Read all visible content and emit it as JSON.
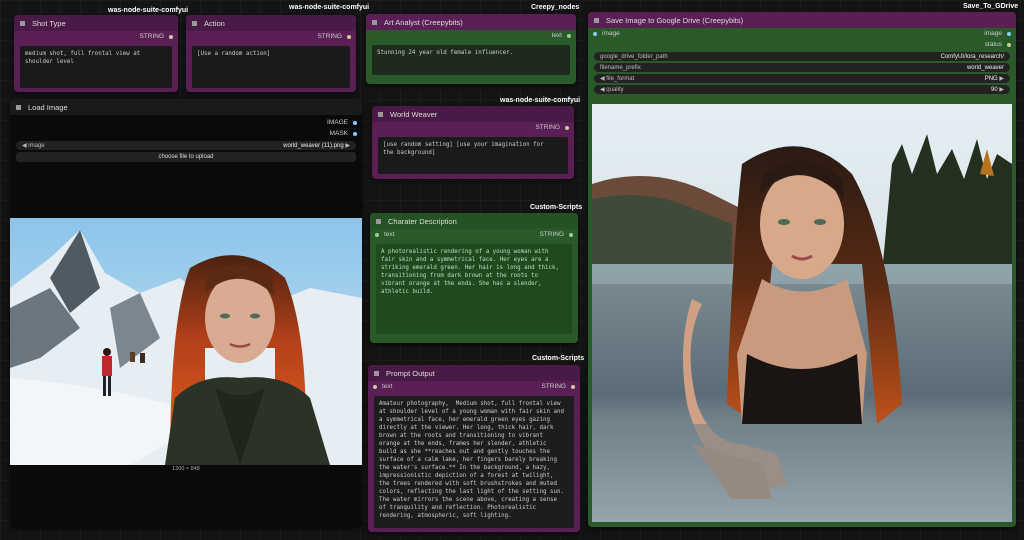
{
  "groups": {
    "shot_type": "was-node-suite-comfyui",
    "action": "was-node-suite-comfyui",
    "art_analyst": "Creepy_nodes",
    "save_drive": "Save_To_GDrive",
    "world_weaver": "was-node-suite-comfyui",
    "character": "Custom-Scripts",
    "prompt_output": "Custom-Scripts"
  },
  "shot_type": {
    "title": "Shot Type",
    "output": "STRING",
    "text": "medium shot, full frontal view at\nshoulder level"
  },
  "action": {
    "title": "Action",
    "output": "STRING",
    "text": "[Use a random action]"
  },
  "art_analyst": {
    "title": "Art Analyst (Creepybits)",
    "output": "text",
    "text": "Stunning 24 year old female influencer."
  },
  "save_drive": {
    "title": "Save Image to Google Drive (Creepybits)",
    "input": "image",
    "out_image": "image",
    "out_status": "status",
    "fields": [
      {
        "label": "google_drive_folder_path",
        "value": "ComfyUI/lora_research/"
      },
      {
        "label": "filename_prefix",
        "value": "world_weaver"
      },
      {
        "label": "file_format",
        "value": "PNG"
      },
      {
        "label": "quality",
        "value": "90"
      }
    ]
  },
  "load_image": {
    "title": "Load Image",
    "out_image": "IMAGE",
    "out_mask": "MASK",
    "image_label": "image",
    "image_value": "world_weaver (11).png",
    "upload_label": "choose file to upload",
    "dims": "1200 × 848"
  },
  "world_weaver": {
    "title": "World Weaver",
    "output": "STRING",
    "text": "[use random setting] [use your imagination for\nthe background]"
  },
  "character": {
    "title": "Charater Description",
    "input": "text",
    "output": "STRING",
    "text": "A photorealistic rendering of a young woman with\nfair skin and a symmetrical face. Her eyes are a\nstriking emerald green. Her hair is long and thick,\ntransitioning from dark brown at the roots to\nvibrant orange at the ends. She has a slender,\nathletic build."
  },
  "prompt_output": {
    "title": "Prompt Output",
    "input": "text",
    "output": "STRING",
    "text": "Amateur photography,  Medium shot, full frontal view\nat shoulder level of a young woman with fair skin and\na symmetrical face, her emerald green eyes gazing\ndirectly at the viewer. Her long, thick hair, dark\nbrown at the roots and transitioning to vibrant\norange at the ends, frames her slender, athletic\nbuild as she **reaches out and gently touches the\nsurface of a calm lake, her fingers barely breaking\nthe water's surface.** In the background, a hazy,\nimpressionistic depiction of a forest at twilight,\nthe trees rendered with soft brushstrokes and muted\ncolors, reflecting the last light of the setting sun.\nThe water mirrors the scene above, creating a sense\nof tranquility and reflection. Photorealistic\nrendering, atmospheric, soft lighting."
  },
  "colors": {
    "purple_node": "#5a1f54",
    "green_node": "#2a5a2a",
    "canvas": "#141414"
  }
}
